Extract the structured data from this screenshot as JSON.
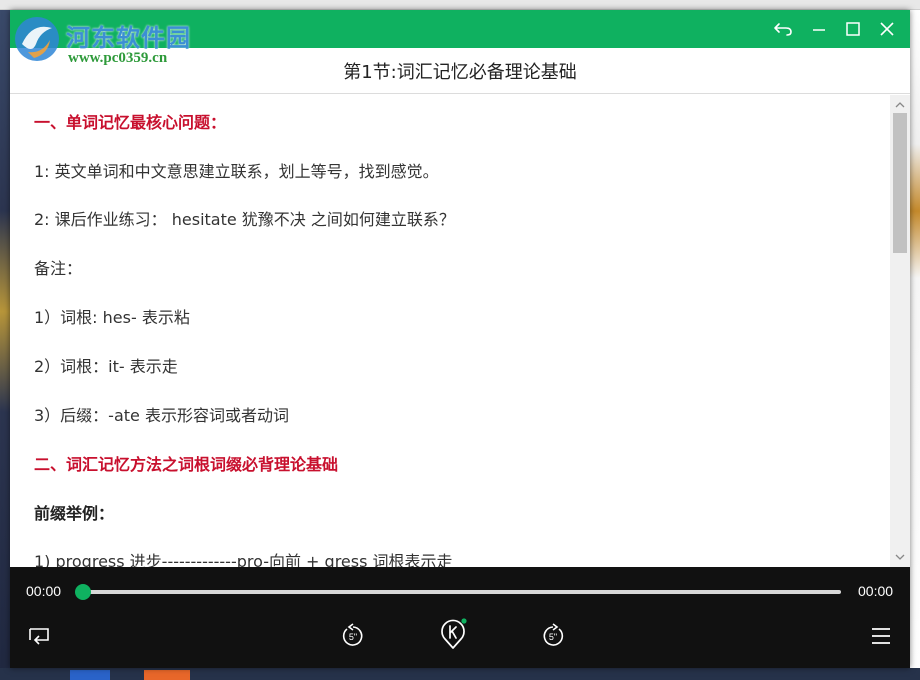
{
  "watermark": {
    "name": "河东软件园",
    "url": "www.pc0359.cn"
  },
  "window": {
    "accent": "#0fb160",
    "buttons": {
      "back": "back-icon",
      "minimize": "minimize-icon",
      "maximize": "maximize-icon",
      "close": "close-icon"
    }
  },
  "header": {
    "title": "第1节:词汇记忆必备理论基础"
  },
  "content": {
    "heading_color": "#c8102e",
    "lines": [
      {
        "style": "heading",
        "text": "一、单词记忆最核心问题："
      },
      {
        "style": "body",
        "text": "1: 英文单词和中文意思建立联系，划上等号，找到感觉。"
      },
      {
        "style": "body",
        "text": "2: 课后作业练习： hesitate 犹豫不决 之间如何建立联系？"
      },
      {
        "style": "body",
        "text": "备注："
      },
      {
        "style": "body",
        "text": "1）词根: hes- 表示粘"
      },
      {
        "style": "body",
        "text": "2）词根：it- 表示走"
      },
      {
        "style": "body",
        "text": "3）后缀：-ate 表示形容词或者动词"
      },
      {
        "style": "heading",
        "text": "二、词汇记忆方法之词根词缀必背理论基础"
      },
      {
        "style": "subheading",
        "text": "前缀举例："
      },
      {
        "style": "body",
        "text": "1) progress 进步-------------pro-向前 + gress 词根表示走"
      }
    ]
  },
  "player": {
    "current_time": "00:00",
    "total_time": "00:00",
    "progress": 0,
    "controls": {
      "playlist": "playlist-icon",
      "rewind": "rewind-5-seconds-icon",
      "play": "play-logo-icon",
      "forward": "forward-5-seconds-icon",
      "menu": "menu-icon"
    },
    "rewind_label": "5\"",
    "forward_label": "5\""
  }
}
